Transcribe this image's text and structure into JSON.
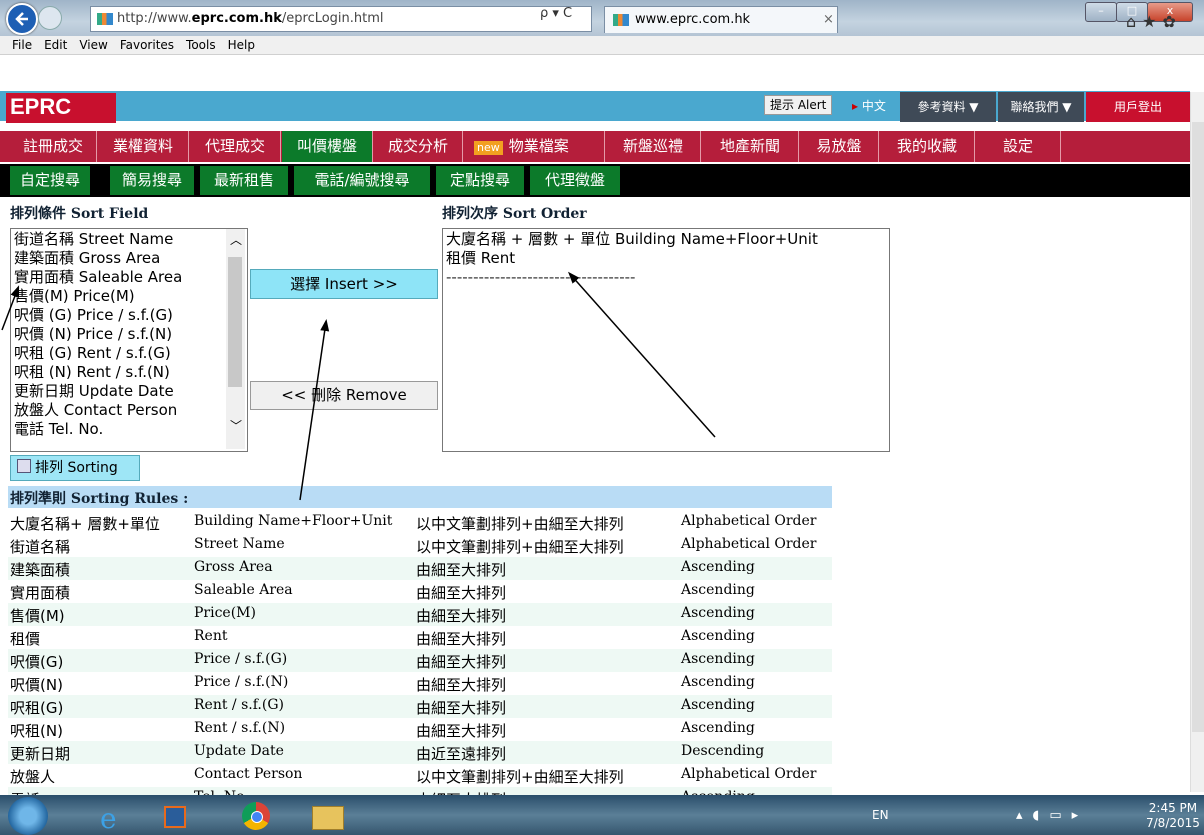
{
  "browser": {
    "url": "http://www.eprc.com.hk/eprcLogin.html",
    "url_prefix": "http://www.",
    "url_host": "eprc.com.hk",
    "url_path": "/eprcLogin.html",
    "search_glyph": "ρ ▾ C",
    "tab_title": "www.eprc.com.hk",
    "tab_close": "×",
    "menu": [
      "File",
      "Edit",
      "View",
      "Favorites",
      "Tools",
      "Help"
    ],
    "win_min": "–",
    "win_max": "□",
    "win_close": "x",
    "toolbar_icons": "⌂★✿"
  },
  "header": {
    "logo": "EPRC",
    "alert_button": "提示 Alert",
    "language_link": "中文",
    "reference_menu": "參考資料 ▼",
    "contact_menu": "聯絡我們 ▼",
    "logout": "用戶登出"
  },
  "nav_main": [
    "註冊成交",
    "業權資料",
    "代理成交",
    "叫價樓盤",
    "成交分析",
    "物業檔案",
    "新盤巡禮",
    "地產新聞",
    "易放盤",
    "我的收藏",
    "設定"
  ],
  "nav_new_badge": "new",
  "nav_sub": [
    "自定搜尋",
    "簡易搜尋",
    "最新租售",
    "電話/編號搜尋",
    "定點搜尋",
    "代理徵盤"
  ],
  "sort_field": {
    "title": "排列條件 Sort Field",
    "items": [
      "街道名稱 Street Name",
      "建築面積 Gross Area",
      "實用面積 Saleable Area",
      "售價(M) Price(M)",
      "呎價 (G) Price / s.f.(G)",
      "呎價 (N) Price / s.f.(N)",
      "呎租 (G) Rent / s.f.(G)",
      "呎租 (N) Rent / s.f.(N)",
      "更新日期 Update Date",
      "放盤人 Contact Person",
      "電話 Tel. No."
    ]
  },
  "buttons": {
    "insert": "選擇  Insert  >>",
    "remove": "<<  刪除  Remove",
    "sorting": "排列 Sorting"
  },
  "sort_order": {
    "title": "排列次序 Sort Order",
    "items": [
      "大廈名稱 + 層數 + 單位 Building Name+Floor+Unit",
      "租價 Rent"
    ],
    "separator": "-----------------------------------"
  },
  "rules": {
    "title": "排列準則 Sorting Rules :",
    "rows": [
      [
        "大廈名稱+ 層數+單位",
        "Building Name+Floor+Unit",
        "以中文筆劃排列+由細至大排列",
        "Alphabetical Order"
      ],
      [
        "街道名稱",
        "Street Name",
        "以中文筆劃排列+由細至大排列",
        "Alphabetical Order"
      ],
      [
        "建築面積",
        "Gross Area",
        "由細至大排列",
        "Ascending"
      ],
      [
        "實用面積",
        "Saleable Area",
        "由細至大排列",
        "Ascending"
      ],
      [
        "售價(M)",
        "Price(M)",
        "由細至大排列",
        "Ascending"
      ],
      [
        "租價",
        "Rent",
        "由細至大排列",
        "Ascending"
      ],
      [
        "呎價(G)",
        "Price / s.f.(G)",
        "由細至大排列",
        "Ascending"
      ],
      [
        "呎價(N)",
        "Price / s.f.(N)",
        "由細至大排列",
        "Ascending"
      ],
      [
        "呎租(G)",
        "Rent / s.f.(G)",
        "由細至大排列",
        "Ascending"
      ],
      [
        "呎租(N)",
        "Rent / s.f.(N)",
        "由細至大排列",
        "Ascending"
      ],
      [
        "更新日期",
        "Update Date",
        "由近至遠排列",
        "Descending"
      ],
      [
        "放盤人",
        "Contact Person",
        "以中文筆劃排列+由細至大排列",
        "Alphabetical Order"
      ],
      [
        "電話",
        "Tel. No.",
        "由細至大排列",
        "Ascending"
      ]
    ]
  },
  "taskbar": {
    "language": "EN",
    "time": "2:45 PM",
    "date": "7/8/2015"
  }
}
